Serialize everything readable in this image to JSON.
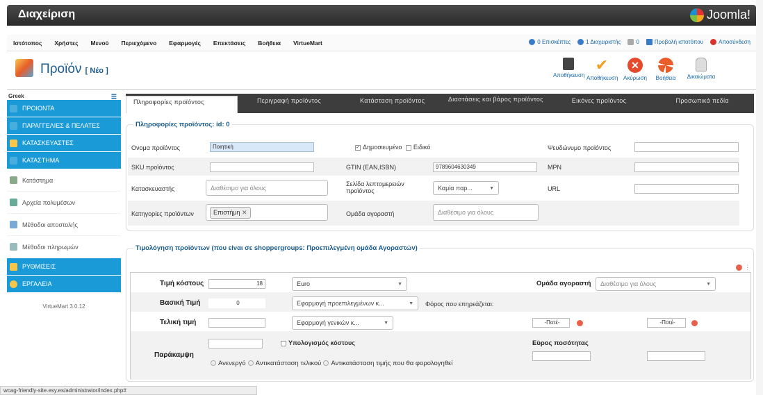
{
  "header": {
    "title": "Διαχείριση",
    "logo_text": "Joomla!"
  },
  "menu": {
    "items": [
      "Ιστότοπος",
      "Χρήστες",
      "Μενού",
      "Περιεχόμενο",
      "Εφαρμογές",
      "Επεκτάσεις",
      "Βοήθεια",
      "VirtueMart"
    ],
    "visitors": "0 Επισκέπτες",
    "admins": "1 Διαχειριστής",
    "messages": "0",
    "view_site": "Προβολή ιστοτόπου",
    "logout": "Αποσύνδεση"
  },
  "toolbar": {
    "title": "Προϊόν",
    "tag": "[ Νέο ]",
    "buttons": [
      "Αποθήκευση",
      "Αποθήκευση",
      "Ακύρωση",
      "Βοήθεια",
      "Δικαιώματα"
    ]
  },
  "sidebar": {
    "lang": "Greek",
    "items": [
      "ΠΡΟΙΟΝΤΑ",
      "ΠΑΡΑΓΓΕΛΙΕΣ & ΠΕΛΑΤΕΣ",
      "ΚΑΤΑΣΚΕΥΑΣΤΕΣ",
      "ΚΑΤΑΣΤΗΜΑ",
      "Κατάστημα",
      "Αρχεία πολυμέσων",
      "Μέθοδοι αποστολής",
      "Μέθοδοι πληρωμών",
      "ΡΥΘΜΙΣΕΙΣ",
      "ΕΡΓΑΛΕΙΑ"
    ],
    "version": "VirtueMart 3.0.12"
  },
  "tabs": [
    "Πληροφορίες προϊόντος",
    "Περιγραφή προϊόντος",
    "Κατάσταση προϊόντος",
    "Διαστάσεις και βάρος προϊόντος",
    "Εικόνες προϊόντος",
    "Προσωπικά πεδία"
  ],
  "info": {
    "legend": "Πληροφορίες προϊόντος: id: 0",
    "name_label": "Ονομα προϊόντος",
    "name_value": "Ποιητική",
    "published": "Δημοσιευμένο",
    "special": "Ειδικό",
    "alias_label": "Ψευδώνυμο προϊόντος",
    "sku_label": "SKU προϊόντος",
    "gtin_label": "GTIN (EAN,ISBN)",
    "gtin_value": "9789604630349",
    "mpn_label": "MPN",
    "manufacturer_label": "Κατασκευαστής",
    "available_all": "Διαθέσιμο για όλους",
    "details_page_label": "Σελίδα λεπτομερειών προϊόντος",
    "details_page_value": "Καμία παρ...",
    "url_label": "URL",
    "categories_label": "Κατηγορίες προϊόντων",
    "category_chip": "Επιστήμη",
    "shopper_group_label": "Ομάδα αγοραστή"
  },
  "pricing": {
    "legend": "Τιμολόγηση προϊόντων (που είναι σε shoppergroups: Προεπιλεγμένη ομάδα Αγοραστών)",
    "cost_label": "Τιμή κόστους",
    "cost_value": "18",
    "currency": "Euro",
    "shopper_group_label": "Ομάδα αγοραστή",
    "shopper_group_value": "Διαθέσιμο για όλους",
    "base_label": "Βασική Τιμή",
    "base_value": "0",
    "base_rule": "Εφαρμογή προεπιλεγμένων κ...",
    "tax_label": "Φόρος που επηρεάζεται:",
    "final_label": "Τελική τιμή",
    "final_rule": "Εφαρμογή γενικών κ...",
    "never1": "-Ποτέ-",
    "never2": "-Ποτέ-",
    "override_label": "Παράκαμψη",
    "calc_cost": "Υπολογισμός κόστους",
    "qty_range": "Εύρος ποσότητας",
    "opt1": "Ανενεργό",
    "opt2": "Αντικατάσταση τελικού",
    "opt3": "Αντικατάσταση τιμής που θα φορολογηθεί"
  },
  "status_url": "wcag-friendly-site.esy.es/administrator/index.php#"
}
